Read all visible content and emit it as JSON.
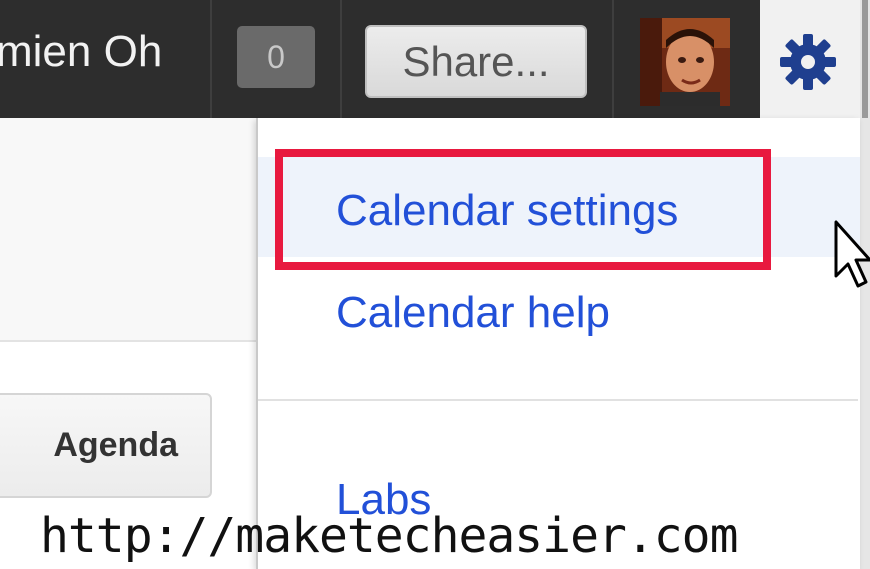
{
  "header": {
    "user_name": "mien Oh",
    "notification_count": "0",
    "share_label": "Share..."
  },
  "view_buttons": {
    "agenda_label": "Agenda"
  },
  "settings_menu": {
    "items": [
      {
        "label": "Calendar settings",
        "highlighted": true
      },
      {
        "label": "Calendar help"
      },
      {
        "label": "Labs"
      }
    ]
  },
  "watermark": "http://maketecheasier.com",
  "colors": {
    "topbar": "#2d2d2d",
    "menu_link": "#2250d8",
    "highlight_box": "#e8193f",
    "gear": "#1f3f8f"
  },
  "icons": {
    "gear": "gear-icon",
    "cursor": "mouse-pointer-icon"
  }
}
